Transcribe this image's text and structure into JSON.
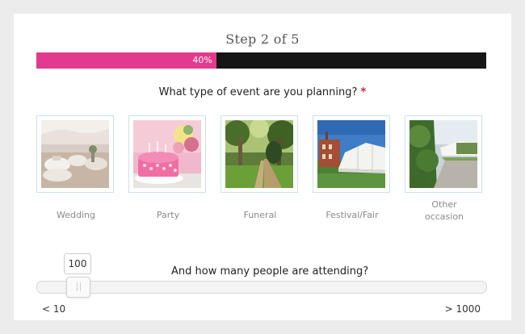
{
  "step": {
    "title": "Step 2 of 5"
  },
  "progress": {
    "label": "40%",
    "value": 0.4,
    "fill_color": "#e23b8e",
    "track_color": "#161616"
  },
  "question": {
    "text": "What type of event are you planning?",
    "required_mark": "*"
  },
  "event_options": [
    {
      "label": "Wedding",
      "image": "wedding-reception-photo"
    },
    {
      "label": "Party",
      "image": "birthday-cake-photo"
    },
    {
      "label": "Funeral",
      "image": "tree-lined-path-photo"
    },
    {
      "label": "Festival/Fair",
      "image": "marquee-tent-photo"
    },
    {
      "label": "Other occasion",
      "image": "garden-marquee-photo"
    }
  ],
  "attendees": {
    "question": "And how many people are attending?",
    "value": "100",
    "fraction": 0.09,
    "min_label": "< 10",
    "max_label": "> 1000"
  }
}
